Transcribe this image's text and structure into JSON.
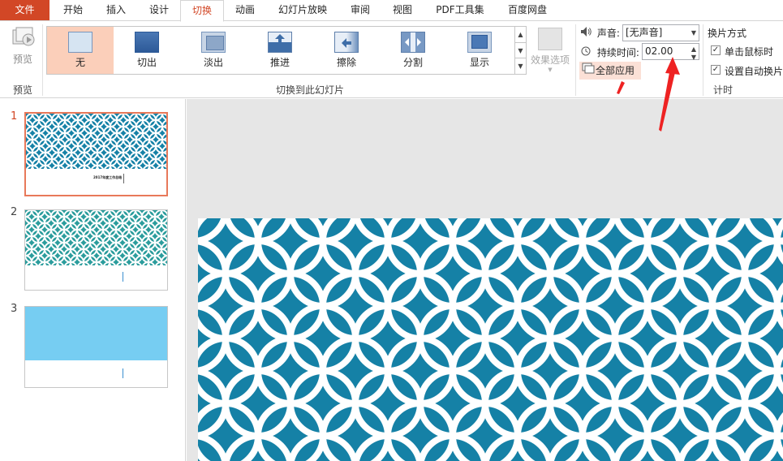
{
  "tabs": [
    {
      "label": "文件"
    },
    {
      "label": "开始"
    },
    {
      "label": "插入"
    },
    {
      "label": "设计"
    },
    {
      "label": "切换"
    },
    {
      "label": "动画"
    },
    {
      "label": "幻灯片放映"
    },
    {
      "label": "审阅"
    },
    {
      "label": "视图"
    },
    {
      "label": "PDF工具集"
    },
    {
      "label": "百度网盘"
    }
  ],
  "ribbon": {
    "preview": {
      "button_label": "预览",
      "group_label": "预览"
    },
    "transitions": {
      "items": [
        {
          "label": "无",
          "icon": "none-transition-icon"
        },
        {
          "label": "切出",
          "icon": "cut-transition-icon"
        },
        {
          "label": "淡出",
          "icon": "fade-transition-icon"
        },
        {
          "label": "推进",
          "icon": "push-transition-icon"
        },
        {
          "label": "擦除",
          "icon": "wipe-transition-icon"
        },
        {
          "label": "分割",
          "icon": "split-transition-icon"
        },
        {
          "label": "显示",
          "icon": "reveal-transition-icon"
        }
      ],
      "selected": "无",
      "group_label": "切换到此幻灯片",
      "effect_options_label": "效果选项"
    },
    "timing": {
      "sound_label": "声音:",
      "sound_value": "[无声音]",
      "duration_label": "持续时间:",
      "duration_value": "02.00",
      "apply_all_label": "全部应用",
      "advance_title": "换片方式",
      "on_click_label": "单击鼠标时",
      "on_click_checked": true,
      "auto_after_label": "设置自动换片",
      "auto_after_checked": true,
      "group_label": "计时"
    }
  },
  "slides": [
    {
      "number": "1",
      "active": true,
      "caption": "2017年度工作总结"
    },
    {
      "number": "2",
      "active": false
    },
    {
      "number": "3",
      "active": false
    }
  ],
  "colors": {
    "accent": "#d24726",
    "selected_bg": "#fbcfba",
    "slide_teal": "#1581a6",
    "slide2_teal": "#2a9c9c",
    "slide3_blue": "#76cdf2",
    "annotation_red": "#ee2222"
  }
}
